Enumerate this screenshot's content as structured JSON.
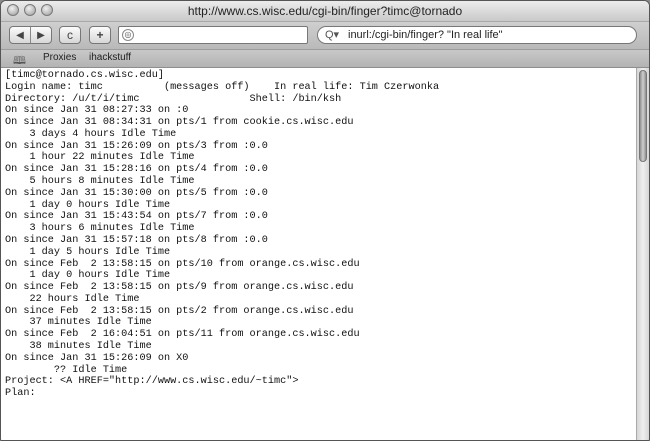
{
  "window": {
    "title": "http://www.cs.wisc.edu/cgi-bin/finger?timc@tornado"
  },
  "toolbar": {
    "back_icon": "◀",
    "forward_icon": "▶",
    "reload_icon": "c",
    "add_icon": "+",
    "url_value": "",
    "search_icon": "Q▾",
    "search_query": "inurl:/cgi-bin/finger? \"In real life\""
  },
  "bookmarks": {
    "icon": "book-icon",
    "items": [
      "Proxies",
      "ihackstuff"
    ]
  },
  "content": {
    "lines": [
      "[timc@tornado.cs.wisc.edu]",
      "Login name: timc          (messages off)    In real life: Tim Czerwonka",
      "Directory: /u/t/i/timc                  Shell: /bin/ksh",
      "On since Jan 31 08:27:33 on :0",
      "On since Jan 31 08:34:31 on pts/1 from cookie.cs.wisc.edu",
      "    3 days 4 hours Idle Time",
      "On since Jan 31 15:26:09 on pts/3 from :0.0",
      "    1 hour 22 minutes Idle Time",
      "On since Jan 31 15:28:16 on pts/4 from :0.0",
      "    5 hours 8 minutes Idle Time",
      "On since Jan 31 15:30:00 on pts/5 from :0.0",
      "    1 day 0 hours Idle Time",
      "On since Jan 31 15:43:54 on pts/7 from :0.0",
      "    3 hours 6 minutes Idle Time",
      "On since Jan 31 15:57:18 on pts/8 from :0.0",
      "    1 day 5 hours Idle Time",
      "On since Feb  2 13:58:15 on pts/10 from orange.cs.wisc.edu",
      "    1 day 0 hours Idle Time",
      "On since Feb  2 13:58:15 on pts/9 from orange.cs.wisc.edu",
      "    22 hours Idle Time",
      "On since Feb  2 13:58:15 on pts/2 from orange.cs.wisc.edu",
      "    37 minutes Idle Time",
      "On since Feb  2 16:04:51 on pts/11 from orange.cs.wisc.edu",
      "    38 minutes Idle Time",
      "On since Jan 31 15:26:09 on X0",
      "        ?? Idle Time",
      "Project: <A HREF=\"http://www.cs.wisc.edu/~timc\">",
      "Plan:"
    ]
  }
}
